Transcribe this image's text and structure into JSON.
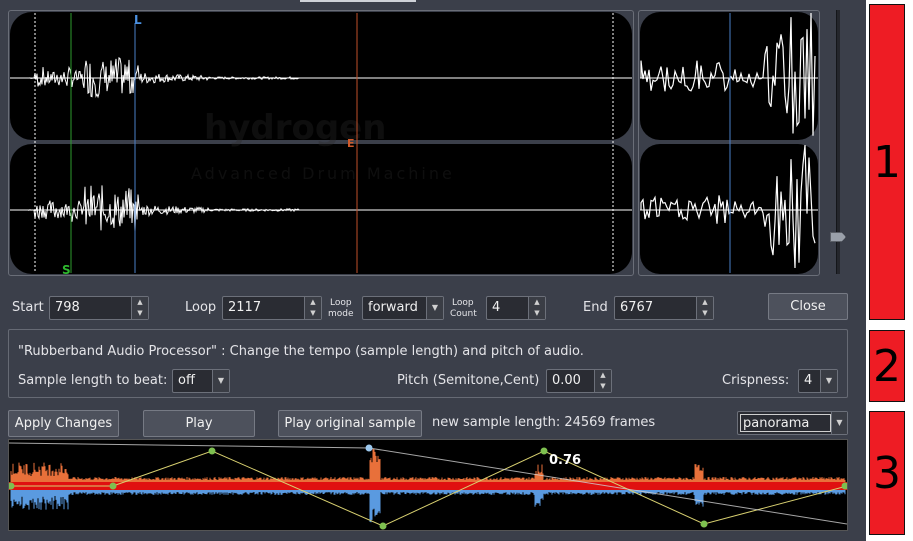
{
  "waveform": {
    "logo": "hydrogen",
    "logo_sub": "Advanced Drum Machine",
    "markers": {
      "left": "L",
      "end": "E",
      "start": "S"
    }
  },
  "controls": {
    "start_label": "Start",
    "start_value": "798",
    "loop_label": "Loop",
    "loop_value": "2117",
    "loop_mode_label_1": "Loop",
    "loop_mode_label_2": "mode",
    "loop_mode_value": "forward",
    "loop_count_label_1": "Loop",
    "loop_count_label_2": "Count",
    "loop_count_value": "4",
    "end_label": "End",
    "end_value": "6767",
    "close_label": "Close"
  },
  "rubberband": {
    "description": "\"Rubberband Audio Processor\" : Change the tempo (sample length) and pitch of audio.",
    "sample_length_label": "Sample length to beat:",
    "sample_length_value": "off",
    "pitch_label": "Pitch (Semitone,Cent)",
    "pitch_value": "0.00",
    "crispness_label": "Crispness:",
    "crispness_value": "4"
  },
  "actions": {
    "apply_label": "Apply Changes",
    "play_label": "Play",
    "play_original_label": "Play original sample",
    "new_length_text": "new sample length: 24569 frames",
    "envelope_select": "panorama"
  },
  "envelope": {
    "value_label": "0.76"
  },
  "annotations": {
    "one": "1",
    "two": "2",
    "three": "3"
  },
  "colors": {
    "annotation": "#ee1c24",
    "pan_line": "#e01010",
    "env_line": "#d8d070"
  }
}
